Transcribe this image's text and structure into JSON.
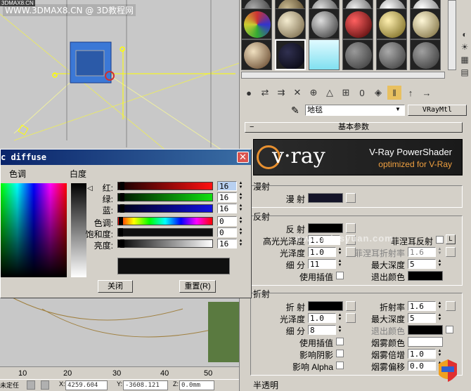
{
  "watermark": {
    "site": "WWW.3DMAX8.CN @ 3D教程网",
    "corner": "3DMAX8.CN",
    "center": "www.missyuan.com"
  },
  "timeline": {
    "ticks": [
      "10",
      "20",
      "30",
      "40",
      "50"
    ]
  },
  "statusbar": {
    "lock_label": "未定任",
    "x_label": "X:",
    "x_value": "4259.604",
    "y_label": "Y:",
    "y_value": "-3608.121",
    "z_label": "Z:",
    "z_value": "0.0mm"
  },
  "material_editor": {
    "material_name": "地毯",
    "material_type": "VRayMtl",
    "rollout_title": "基本参数",
    "vray_banner": {
      "logo": "v·ray",
      "title": "V-Ray PowerShader",
      "subtitle": "optimized for V-Ray"
    },
    "diffuse": {
      "section": "漫射",
      "label": "漫 射",
      "color": "#141428"
    },
    "reflection": {
      "section": "反射",
      "reflect_label": "反 射",
      "reflect_color": "#000000",
      "hilight_label": "高光光泽度",
      "hilight_value": "1.0",
      "fresnel_label": "菲涅耳反射",
      "fresnel_ior_label": "菲涅耳折射率",
      "fresnel_ior_value": "1.6",
      "l_label": "L",
      "gloss_label": "光泽度",
      "gloss_value": "1.0",
      "subdivs_label": "细 分",
      "subdivs_value": "11",
      "interp_label": "使用插值",
      "max_depth_label": "最大深度",
      "max_depth_value": "5",
      "exit_color_label": "退出颜色",
      "exit_color": "#000000"
    },
    "refraction": {
      "section": "折射",
      "refract_label": "折 射",
      "refract_color": "#000000",
      "ior_label": "折射率",
      "ior_value": "1.6",
      "gloss_label": "光泽度",
      "gloss_value": "1.0",
      "max_depth_label": "最大深度",
      "max_depth_value": "5",
      "subdivs_label": "细 分",
      "subdivs_value": "8",
      "exit_color_label": "退出颜色",
      "exit_color": "#000000",
      "interp_label": "使用插值",
      "fog_color_label": "烟雾颜色",
      "fog_color": "#ffffff",
      "shadow_label": "影响阴影",
      "fog_mult_label": "烟雾倍增",
      "fog_mult_value": "1.0",
      "alpha_label": "影响 Alpha",
      "fog_bias_label": "烟雾偏移",
      "fog_bias_value": "0.0"
    },
    "translucency": {
      "section": "半透明"
    },
    "sample_slots": [
      "#444444",
      "#6b5a3a",
      "#7a7a7a",
      "#8a8a8a",
      "#9a9a9a",
      "mosaic",
      "#c8b890",
      "#6d6d6d",
      "#c01010",
      "#d0c070",
      "#d8c880",
      "#e8d8b8",
      "#101020",
      "#a0e8f0",
      "#606060",
      "#707070",
      "#686868"
    ]
  },
  "color_dialog": {
    "title": "c diffuse",
    "hue_header": "色调",
    "white_header": "白度",
    "channels": [
      {
        "label": "红:",
        "value": "16"
      },
      {
        "label": "绿:",
        "value": "16"
      },
      {
        "label": "蓝:",
        "value": "16"
      }
    ],
    "hsv": [
      {
        "label": "色调:",
        "value": "0"
      },
      {
        "label": "饱和度:",
        "value": "0"
      },
      {
        "label": "亮度:",
        "value": "16"
      }
    ],
    "current_color": "#101010",
    "close_button": "关闭",
    "reset_button": "重置(R)"
  }
}
